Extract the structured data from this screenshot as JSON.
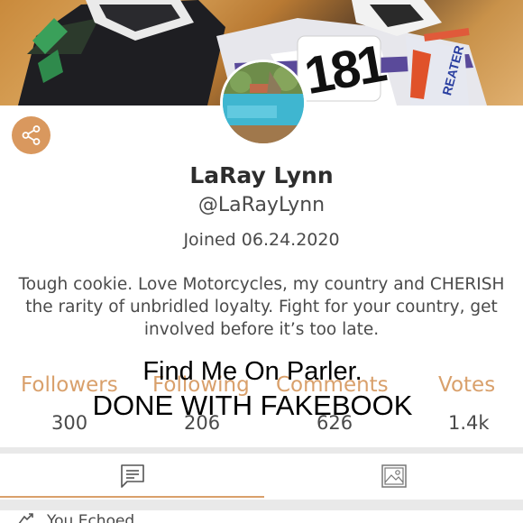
{
  "profile": {
    "name": "LaRay Lynn",
    "handle": "@LaRayLynn",
    "joined": "Joined 06.24.2020",
    "bio": "Tough cookie. Love Motorcycles, my country and CHERISH the rarity of unbridled loyalty. Fight for your country, get involved before it’s too late."
  },
  "cover": {
    "race_number": "181",
    "sponsor_text": "REATER"
  },
  "overlay": {
    "line1": "Find Me On Parler.",
    "line2": "DONE WITH FAKEBOOK"
  },
  "stats": [
    {
      "label": "Followers",
      "value": "300"
    },
    {
      "label": "Following",
      "value": "206"
    },
    {
      "label": "Comments",
      "value": "626"
    },
    {
      "label": "Votes",
      "value": "1.4k"
    }
  ],
  "tabs": [
    {
      "icon": "posts-icon",
      "active": true
    },
    {
      "icon": "image-icon",
      "active": false
    }
  ],
  "first_post": {
    "text": "You Echoed"
  },
  "colors": {
    "accent": "#d9a06b",
    "share_bg": "#d9985e",
    "separator": "#e9e9e9"
  }
}
